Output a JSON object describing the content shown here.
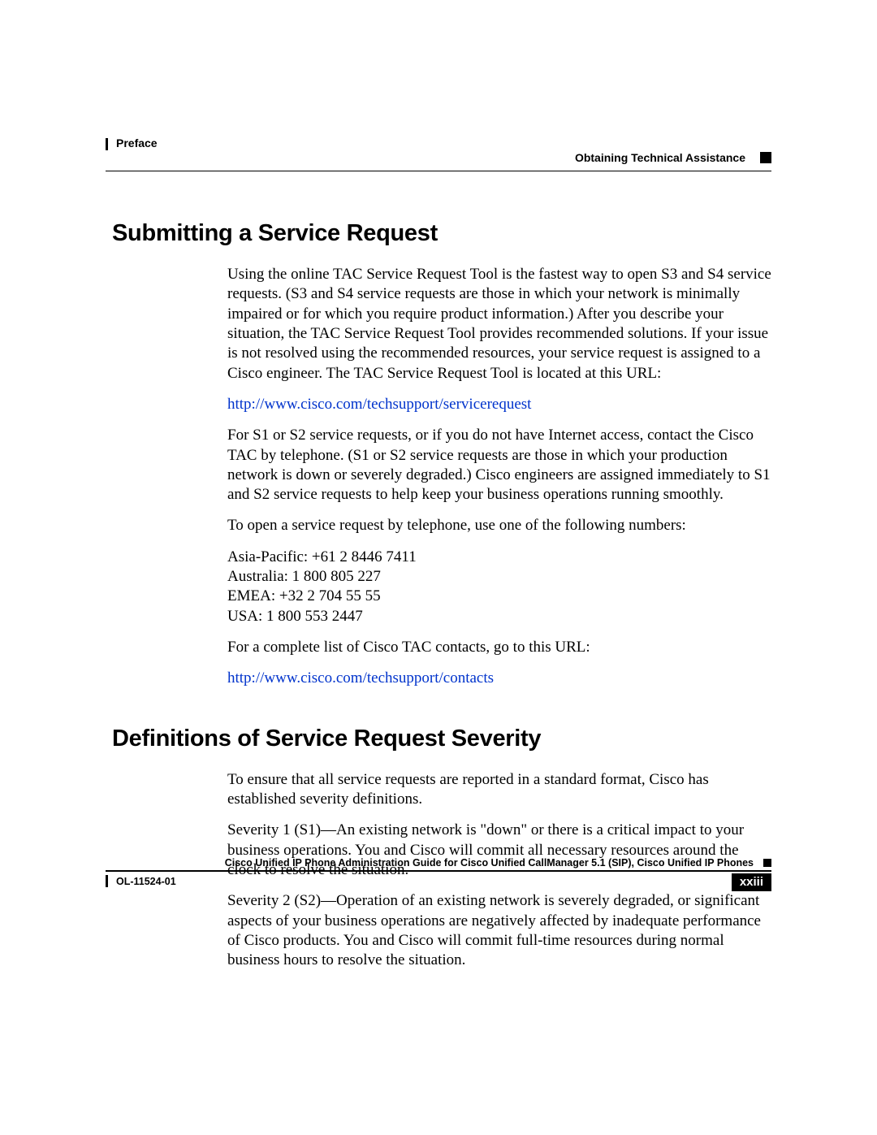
{
  "header": {
    "left": "Preface",
    "right": "Obtaining Technical Assistance"
  },
  "section1": {
    "heading": "Submitting a Service Request",
    "p1": "Using the online TAC Service Request Tool is the fastest way to open S3 and S4 service requests. (S3 and S4 service requests are those in which your network is minimally impaired or for which you require product information.) After you describe your situation, the TAC Service Request Tool provides recommended solutions. If your issue is not resolved using the recommended resources, your service request is assigned to a Cisco engineer. The TAC Service Request Tool is located at this URL:",
    "link1": "http://www.cisco.com/techsupport/servicerequest",
    "p2": "For S1 or S2 service requests, or if you do not have Internet access, contact the Cisco TAC by telephone. (S1 or S2 service requests are those in which your production network is down or severely degraded.) Cisco engineers are assigned immediately to S1 and S2 service requests to help keep your business operations running smoothly.",
    "p3": "To open a service request by telephone, use one of the following numbers:",
    "phones": {
      "ap": "Asia-Pacific: +61 2 8446 7411",
      "au": "Australia: 1 800 805 227",
      "emea": "EMEA: +32 2 704 55 55",
      "usa": "USA: 1 800 553 2447"
    },
    "p4": "For a complete list of Cisco TAC contacts, go to this URL:",
    "link2": "http://www.cisco.com/techsupport/contacts"
  },
  "section2": {
    "heading": "Definitions of Service Request Severity",
    "p1": "To ensure that all service requests are reported in a standard format, Cisco has established severity definitions.",
    "p2": "Severity 1 (S1)—An existing network is \"down\" or there is a critical impact to your business operations. You and Cisco will commit all necessary resources around the clock to resolve the situation.",
    "p3": "Severity 2 (S2)—Operation of an existing network is severely degraded, or significant aspects of your business operations are negatively affected by inadequate performance of Cisco products. You and Cisco will commit full-time resources during normal business hours to resolve the situation."
  },
  "footer": {
    "title": "Cisco Unified IP Phone Administration Guide for Cisco Unified CallManager 5.1 (SIP), Cisco Unified IP Phones",
    "doc": "OL-11524-01",
    "page": "xxiii"
  }
}
